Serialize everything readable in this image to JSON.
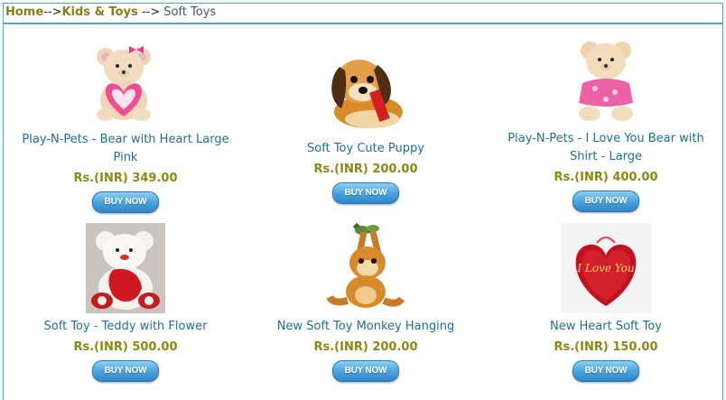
{
  "breadcrumb": {
    "home": "Home",
    "sep1": "-->",
    "category": "Kids & Toys",
    "sep2": " --> ",
    "current": "Soft Toys"
  },
  "buy_label": "BUY NOW",
  "products": [
    {
      "name": "Play-N-Pets - Bear with Heart Large Pink",
      "price": "Rs.(INR) 349.00",
      "icon": "teddy-bear-pink-heart"
    },
    {
      "name": "Soft Toy Cute Puppy",
      "price": "Rs.(INR) 200.00",
      "icon": "puppy"
    },
    {
      "name": "Play-N-Pets - I Love You Bear with Shirt - Large",
      "price": "Rs.(INR) 400.00",
      "icon": "teddy-bear-shirt"
    },
    {
      "name": "Soft Toy - Teddy with Flower",
      "price": "Rs.(INR) 500.00",
      "icon": "teddy-bear-flower"
    },
    {
      "name": "New Soft Toy Monkey Hanging",
      "price": "Rs.(INR) 200.00",
      "icon": "monkey-hanging"
    },
    {
      "name": "New Heart Soft Toy",
      "price": "Rs.(INR) 150.00",
      "icon": "heart-i-love-you"
    }
  ]
}
